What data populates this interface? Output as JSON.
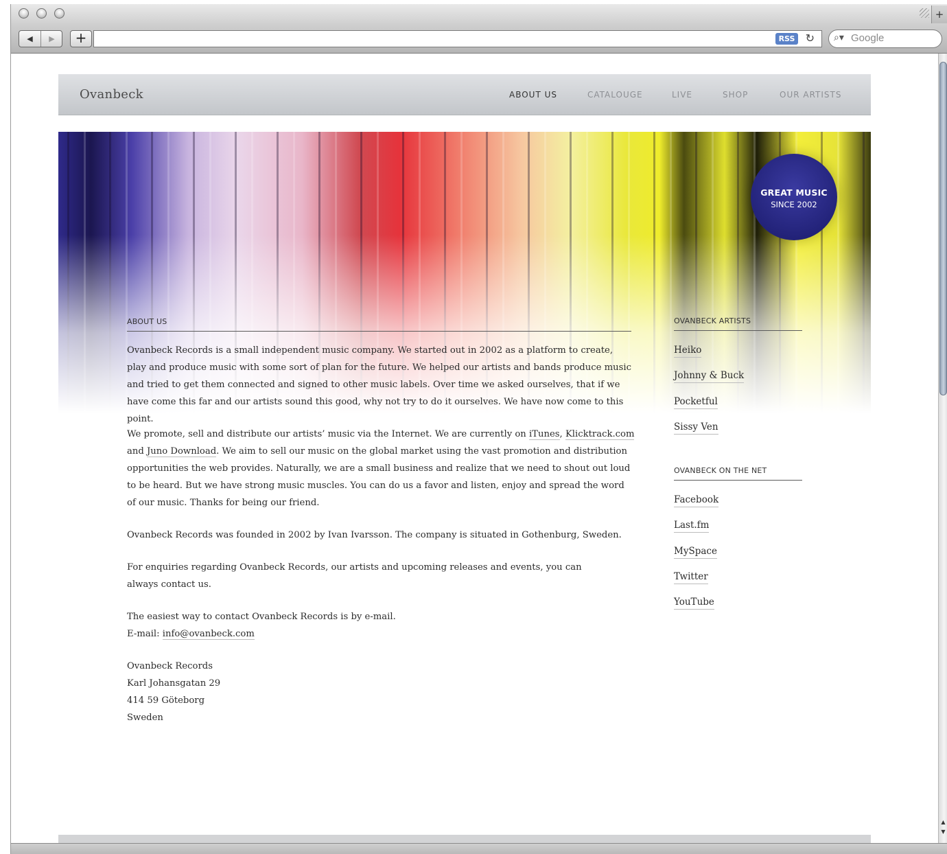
{
  "browser": {
    "back_glyph": "◀",
    "forward_glyph": "▶",
    "add_glyph": "+",
    "rss_label": "RSS",
    "reload_glyph": "↻",
    "search_placeholder": "Google",
    "new_tab_glyph": "+"
  },
  "site": {
    "logo": "Ovanbeck",
    "nav": [
      "ABOUT US",
      "CATALOUGE",
      "LIVE",
      "SHOP",
      "OUR ARTISTS"
    ],
    "active_nav": "ABOUT US"
  },
  "badge": {
    "line1": "GREAT MUSIC",
    "line2": "SINCE 2002",
    "color": "#26267f"
  },
  "about": {
    "title": "ABOUT US",
    "p1": "Ovanbeck Records is a small independent music company. We started out in 2002 as a platform to create, play and produce music with some sort of plan for the future. We helped our artists and bands produce music and tried to get them connected and signed to other music labels. Over time we asked ourselves, that if we have come this far and our artists sound this good, why not try to do it ourselves. We have now come to this point.",
    "p2_a": "We promote, sell and distribute our artists’ music via the Internet. We are currently on ",
    "link_itunes": "iTunes",
    "p2_sep": ", ",
    "link_klicktrack": "Klicktrack.com",
    "p2_and": " and ",
    "link_juno": "Juno Download",
    "p2_b": ". We aim to sell our music on the global market using the vast promotion and distribution opportunities the web provides. Naturally, we are a small business and realize that we need to shout out loud to be heard. But we have strong music muscles. You can do us a favor and listen, enjoy and spread the word of our music. Thanks for being our friend.",
    "p3": "Ovanbeck Records was founded in 2002 by Ivan Ivarsson. The company is situated in Gothenburg, Sweden.",
    "p4": "For enquiries regarding Ovanbeck Records, our artists and upcoming releases and events, you can always contact us.",
    "p5_line1": "The easiest way to contact Ovanbeck Records is by e-mail.",
    "p5_email_label": "E-mail: ",
    "email": "info@ovanbeck.com",
    "address": [
      "Ovanbeck Records",
      "Karl Johansgatan 29",
      "414 59 Göteborg",
      "Sweden"
    ]
  },
  "sidebar": {
    "artists_title": "OVANBECK ARTISTS",
    "artists": [
      "Heiko",
      "Johnny & Buck",
      "Pocketful",
      "Sissy Ven"
    ],
    "net_title": "OVANBECK ON THE NET",
    "net": [
      "Facebook",
      "Last.fm",
      "MySpace",
      "Twitter",
      "YouTube"
    ]
  },
  "scrollbar": {
    "up_glyph": "▲",
    "down_glyph": "▼"
  }
}
